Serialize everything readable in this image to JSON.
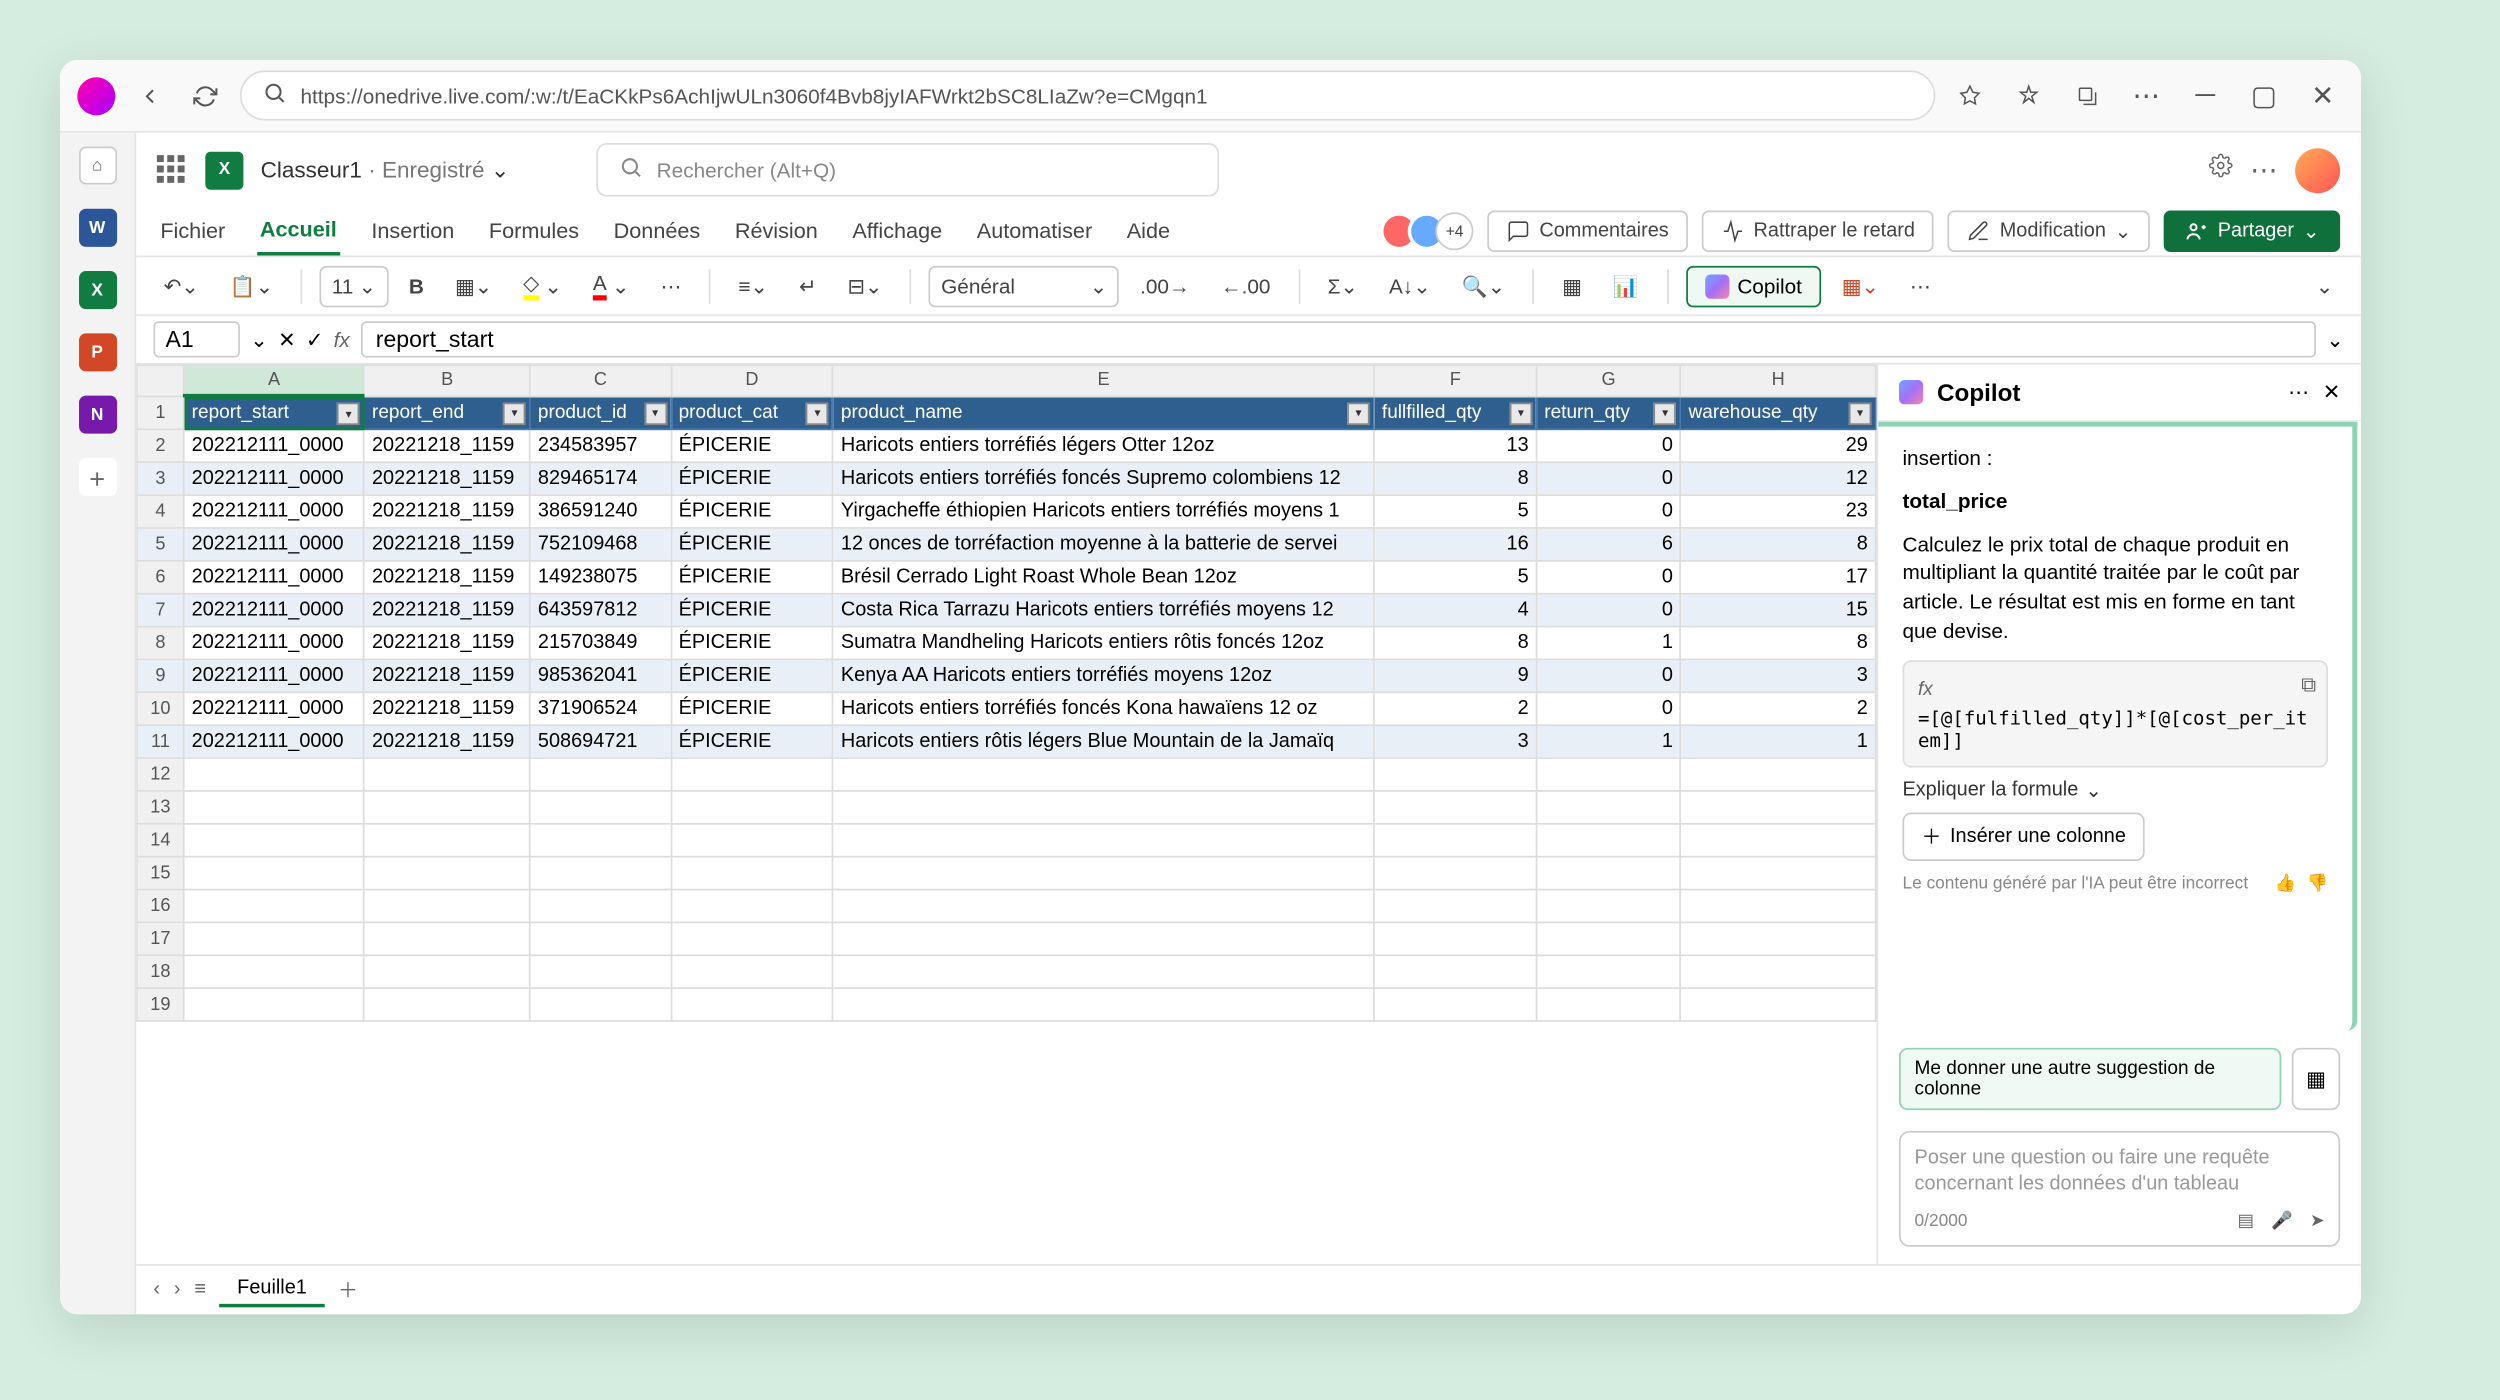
{
  "browser": {
    "url": "https://onedrive.live.com/:w:/t/EaCKkPs6AchIjwULn3060f4Bvb8jyIAFWrkt2bSC8LIaZw?e=CMgqn1"
  },
  "title_bar": {
    "doc_name": "Classeur1",
    "saved_status": "· Enregistré",
    "search_placeholder": "Rechercher (Alt+Q)"
  },
  "tabs": {
    "items": [
      "Fichier",
      "Accueil",
      "Insertion",
      "Formules",
      "Données",
      "Révision",
      "Affichage",
      "Automatiser",
      "Aide"
    ],
    "active_index": 1,
    "presence_extra": "+4",
    "comments": "Commentaires",
    "catchup": "Rattraper le retard",
    "editing": "Modification",
    "share": "Partager"
  },
  "ribbon": {
    "font_size": "11",
    "number_format": "Général",
    "copilot": "Copilot"
  },
  "formula_bar": {
    "cell": "A1",
    "value": "report_start"
  },
  "grid": {
    "columns": [
      "A",
      "B",
      "C",
      "D",
      "E",
      "F",
      "G",
      "H"
    ],
    "widths": [
      100,
      92,
      78,
      90,
      300,
      90,
      80,
      108
    ],
    "headers": [
      "report_start",
      "report_end",
      "product_id",
      "product_cat",
      "product_name",
      "fullfilled_qty",
      "return_qty",
      "warehouse_qty"
    ],
    "rows": [
      {
        "n": 2,
        "cells": [
          "202212111_0000",
          "20221218_1159",
          "234583957",
          "ÉPICERIE",
          "Haricots entiers torréfiés légers Otter 12oz",
          "13",
          "0",
          "29"
        ]
      },
      {
        "n": 3,
        "cells": [
          "202212111_0000",
          "20221218_1159",
          "829465174",
          "ÉPICERIE",
          "Haricots entiers torréfiés foncés Supremo colombiens 12",
          "8",
          "0",
          "12"
        ]
      },
      {
        "n": 4,
        "cells": [
          "202212111_0000",
          "20221218_1159",
          "386591240",
          "ÉPICERIE",
          "Yirgacheffe éthiopien Haricots entiers torréfiés moyens 1",
          "5",
          "0",
          "23"
        ]
      },
      {
        "n": 5,
        "cells": [
          "202212111_0000",
          "20221218_1159",
          "752109468",
          "ÉPICERIE",
          "12 onces de torréfaction moyenne à la batterie de servei",
          "16",
          "6",
          "8"
        ]
      },
      {
        "n": 6,
        "cells": [
          "202212111_0000",
          "20221218_1159",
          "149238075",
          "ÉPICERIE",
          "Brésil Cerrado Light Roast Whole Bean 12oz",
          "5",
          "0",
          "17"
        ]
      },
      {
        "n": 7,
        "cells": [
          "202212111_0000",
          "20221218_1159",
          "643597812",
          "ÉPICERIE",
          "Costa Rica Tarrazu Haricots entiers torréfiés moyens 12",
          "4",
          "0",
          "15"
        ]
      },
      {
        "n": 8,
        "cells": [
          "202212111_0000",
          "20221218_1159",
          "215703849",
          "ÉPICERIE",
          "Sumatra Mandheling Haricots entiers rôtis foncés 12oz",
          "8",
          "1",
          "8"
        ]
      },
      {
        "n": 9,
        "cells": [
          "202212111_0000",
          "20221218_1159",
          "985362041",
          "ÉPICERIE",
          "Kenya AA Haricots entiers torréfiés moyens 12oz",
          "9",
          "0",
          "3"
        ]
      },
      {
        "n": 10,
        "cells": [
          "202212111_0000",
          "20221218_1159",
          "371906524",
          "ÉPICERIE",
          "Haricots entiers torréfiés foncés Kona hawaïens 12 oz",
          "2",
          "0",
          "2"
        ]
      },
      {
        "n": 11,
        "cells": [
          "202212111_0000",
          "20221218_1159",
          "508694721",
          "ÉPICERIE",
          "Haricots entiers rôtis légers Blue Mountain de la Jamaïq",
          "3",
          "1",
          "1"
        ]
      }
    ],
    "empty_rows": [
      12,
      13,
      14,
      15,
      16,
      17,
      18,
      19
    ]
  },
  "sheet": {
    "name": "Feuille1"
  },
  "copilot_panel": {
    "title": "Copilot",
    "insertion_label": "insertion :",
    "col_name": "total_price",
    "description": "Calculez le prix total de chaque produit en multipliant la quantité traitée par le coût par article. Le résultat est mis en forme en tant que devise.",
    "formula": "=[@[fulfilled_qty]]*[@[cost_per_item]]",
    "explain": "Expliquer la formule",
    "insert": "Insérer une colonne",
    "disclaimer": "Le contenu généré par l'IA peut être incorrect",
    "suggest": "Me donner une autre suggestion de colonne",
    "input_placeholder": "Poser une question ou faire une requête concernant les données d'un tableau",
    "char_count": "0/2000"
  }
}
